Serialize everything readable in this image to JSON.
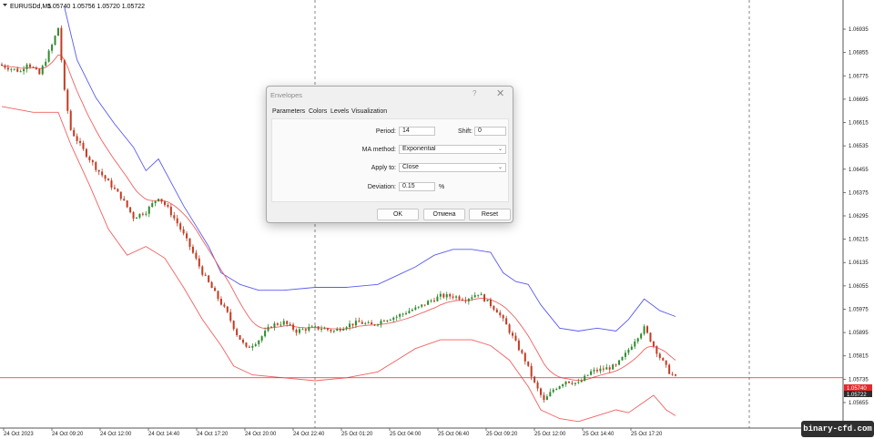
{
  "header": {
    "symbol_label": "EURUSDd,M5",
    "ohlc": "1.05740 1.05756 1.05720 1.05722"
  },
  "chart_data": {
    "type": "candlestick",
    "symbol": "EURUSDd",
    "timeframe": "M5",
    "ylim": [
      1.0558,
      1.0701
    ],
    "price_ticks": [
      "1.06935",
      "1.06855",
      "1.06775",
      "1.06695",
      "1.06615",
      "1.06535",
      "1.06455",
      "1.06375",
      "1.06295",
      "1.06215",
      "1.06135",
      "1.06055",
      "1.05975",
      "1.05895",
      "1.05815",
      "1.05735",
      "1.05655"
    ],
    "time_ticks": [
      "24 Oct 2023",
      "24 Oct 09:20",
      "24 Oct 12:00",
      "24 Oct 14:40",
      "24 Oct 17:20",
      "24 Oct 20:00",
      "24 Oct 22:40",
      "25 Oct 01:20",
      "25 Oct 04:00",
      "25 Oct 06:40",
      "25 Oct 09:20",
      "25 Oct 12:00",
      "25 Oct 14:40",
      "25 Oct 17:20"
    ],
    "bid_label": "1.05740",
    "ask_label": "1.05722",
    "current_price": 1.0574,
    "price_path": [
      [
        0,
        1.0681
      ],
      [
        3,
        1.068
      ],
      [
        6,
        1.0679
      ],
      [
        8,
        1.0682
      ],
      [
        10,
        1.068
      ],
      [
        12,
        1.0678
      ],
      [
        14,
        1.0683
      ],
      [
        16,
        1.0688
      ],
      [
        18,
        1.0694
      ],
      [
        20,
        1.0672
      ],
      [
        22,
        1.0659
      ],
      [
        26,
        1.0652
      ],
      [
        30,
        1.0646
      ],
      [
        34,
        1.0641
      ],
      [
        38,
        1.0636
      ],
      [
        42,
        1.0629
      ],
      [
        46,
        1.0631
      ],
      [
        50,
        1.0636
      ],
      [
        53,
        1.0632
      ],
      [
        56,
        1.0627
      ],
      [
        60,
        1.0619
      ],
      [
        64,
        1.061
      ],
      [
        68,
        1.0603
      ],
      [
        72,
        1.0596
      ],
      [
        75,
        1.0589
      ],
      [
        78,
        1.0584
      ],
      [
        82,
        1.0587
      ],
      [
        86,
        1.0592
      ],
      [
        90,
        1.0593
      ],
      [
        94,
        1.059
      ],
      [
        98,
        1.0591
      ],
      [
        102,
        1.0591
      ],
      [
        106,
        1.059
      ],
      [
        110,
        1.0592
      ],
      [
        114,
        1.0593
      ],
      [
        118,
        1.0592
      ],
      [
        122,
        1.0594
      ],
      [
        126,
        1.0595
      ],
      [
        130,
        1.0597
      ],
      [
        133,
        1.0598
      ],
      [
        136,
        1.06
      ],
      [
        140,
        1.0602
      ],
      [
        144,
        1.0602
      ],
      [
        148,
        1.0601
      ],
      [
        152,
        1.0603
      ],
      [
        155,
        1.06
      ],
      [
        158,
        1.0597
      ],
      [
        161,
        1.0592
      ],
      [
        164,
        1.0586
      ],
      [
        167,
        1.058
      ],
      [
        170,
        1.0572
      ],
      [
        173,
        1.0566
      ],
      [
        176,
        1.057
      ],
      [
        180,
        1.0573
      ],
      [
        184,
        1.0572
      ],
      [
        188,
        1.0576
      ],
      [
        192,
        1.0577
      ],
      [
        196,
        1.0578
      ],
      [
        199,
        1.0582
      ],
      [
        202,
        1.0587
      ],
      [
        205,
        1.0591
      ],
      [
        208,
        1.0585
      ],
      [
        210,
        1.0581
      ],
      [
        213,
        1.0576
      ],
      [
        215,
        1.0574
      ]
    ],
    "series": [
      {
        "name": "Upper envelope",
        "color": "#5a5af0",
        "values": [
          [
            20,
            1.0701
          ],
          [
            24,
            1.0683
          ],
          [
            30,
            1.067
          ],
          [
            36,
            1.0661
          ],
          [
            42,
            1.0653
          ],
          [
            46,
            1.0645
          ],
          [
            50,
            1.0649
          ],
          [
            54,
            1.0641
          ],
          [
            58,
            1.0633
          ],
          [
            62,
            1.0626
          ],
          [
            66,
            1.0619
          ],
          [
            70,
            1.061
          ],
          [
            76,
            1.0606
          ],
          [
            82,
            1.0604
          ],
          [
            90,
            1.0604
          ],
          [
            100,
            1.0605
          ],
          [
            110,
            1.0605
          ],
          [
            120,
            1.0606
          ],
          [
            126,
            1.0609
          ],
          [
            132,
            1.0612
          ],
          [
            138,
            1.0616
          ],
          [
            144,
            1.0618
          ],
          [
            150,
            1.0618
          ],
          [
            156,
            1.0617
          ],
          [
            160,
            1.061
          ],
          [
            164,
            1.0607
          ],
          [
            168,
            1.0606
          ],
          [
            172,
            1.0599
          ],
          [
            178,
            1.0591
          ],
          [
            184,
            1.059
          ],
          [
            190,
            1.0591
          ],
          [
            196,
            1.059
          ],
          [
            200,
            1.0594
          ],
          [
            205,
            1.0601
          ],
          [
            210,
            1.0597
          ],
          [
            215,
            1.0595
          ]
        ]
      },
      {
        "name": "Lower envelope",
        "color": "#f06060",
        "values": [
          [
            0,
            1.0667
          ],
          [
            10,
            1.0665
          ],
          [
            18,
            1.0665
          ],
          [
            22,
            1.0654
          ],
          [
            28,
            1.064
          ],
          [
            34,
            1.0625
          ],
          [
            40,
            1.0616
          ],
          [
            46,
            1.0619
          ],
          [
            52,
            1.0615
          ],
          [
            58,
            1.0605
          ],
          [
            64,
            1.0594
          ],
          [
            70,
            1.0585
          ],
          [
            74,
            1.0578
          ],
          [
            80,
            1.0575
          ],
          [
            90,
            1.0574
          ],
          [
            100,
            1.0573
          ],
          [
            110,
            1.0574
          ],
          [
            120,
            1.0576
          ],
          [
            126,
            1.058
          ],
          [
            132,
            1.0584
          ],
          [
            140,
            1.0587
          ],
          [
            150,
            1.0587
          ],
          [
            156,
            1.0585
          ],
          [
            162,
            1.058
          ],
          [
            168,
            1.0571
          ],
          [
            172,
            1.0563
          ],
          [
            178,
            1.056
          ],
          [
            184,
            1.0559
          ],
          [
            190,
            1.0561
          ],
          [
            196,
            1.0563
          ],
          [
            200,
            1.0562
          ],
          [
            204,
            1.0565
          ],
          [
            208,
            1.0568
          ],
          [
            212,
            1.0563
          ],
          [
            215,
            1.0561
          ]
        ]
      },
      {
        "name": "Moving average",
        "color": "#f06060"
      }
    ]
  },
  "dialog": {
    "title": "Envelopes",
    "help_glyph": "?",
    "close_glyph": "✕",
    "tabs": [
      "Parameters",
      "Colors",
      "Levels",
      "Visualization"
    ],
    "period_label": "Period:",
    "period_value": "14",
    "shift_label": "Shift:",
    "shift_value": "0",
    "ma_method_label": "MA method:",
    "ma_method_value": "Exponential",
    "apply_to_label": "Apply to:",
    "apply_to_value": "Close",
    "deviation_label": "Deviation:",
    "deviation_value": "0.15",
    "deviation_unit": "%",
    "ok_label": "OK",
    "cancel_label": "Отмена",
    "reset_label": "Reset"
  },
  "watermark": {
    "text": "binary-cfd.com"
  },
  "colors": {
    "bull": "#2e8b2e",
    "bear": "#c23b22",
    "upper_band": "#5a5af0",
    "lower_band": "#f06060",
    "price_line": "#f06060",
    "grid": "#4a4a4a"
  }
}
